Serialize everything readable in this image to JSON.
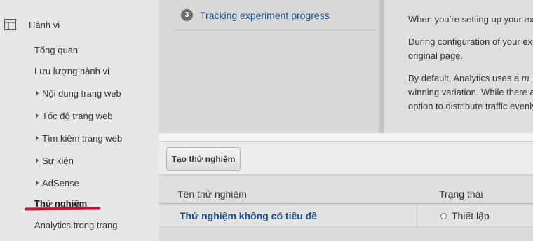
{
  "sidebar": {
    "section_label": "Hành vi",
    "section_icon": "layout-icon",
    "items": [
      {
        "label": "Tổng quan",
        "expandable": false
      },
      {
        "label": "Lưu lượng hành vi",
        "expandable": false
      },
      {
        "label": "Nội dung trang web",
        "expandable": true
      },
      {
        "label": "Tốc độ trang web",
        "expandable": true
      },
      {
        "label": "Tìm kiếm trang web",
        "expandable": true
      },
      {
        "label": "Sự kiện",
        "expandable": true
      },
      {
        "label": "AdSense",
        "expandable": true
      },
      {
        "label": "Thử nghiệm",
        "expandable": false,
        "active": true
      },
      {
        "label": "Analytics trong trang",
        "expandable": false
      }
    ],
    "highlight_color": "#c8102e"
  },
  "overlay": {
    "step_number": "3",
    "step_link": "Tracking experiment progress",
    "text_line1": "When you’re setting up your ex",
    "text_line2a": "During configuration of your exp",
    "text_line2b": "original page.",
    "text_line3a_prefix": "By default, Analytics uses a ",
    "text_line3a_em": "m",
    "text_line3b": "winning variation. While there a",
    "text_line3c": "option to distribute traffic evenly"
  },
  "toolbar": {
    "create_label": "Tạo thử nghiệm"
  },
  "table": {
    "headers": {
      "name": "Tên thử nghiệm",
      "status": "Trạng thái"
    },
    "rows": [
      {
        "name": "Thử nghiệm không có tiêu đề",
        "status": "Thiết lập"
      }
    ]
  },
  "colors": {
    "link": "#1c4f8a",
    "sidebar_bg": "#e6e6e6"
  }
}
